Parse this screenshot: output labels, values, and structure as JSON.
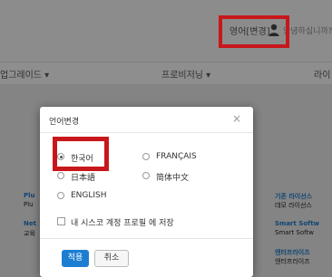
{
  "header": {
    "lang_link": "영어[변경]",
    "greeting": "안녕하십니까?"
  },
  "nav": {
    "items": [
      {
        "label": "업그레이드 ▾"
      },
      {
        "label": "프로비저닝 ▾"
      },
      {
        "label": "라이"
      }
    ]
  },
  "background": {
    "left": [
      "Plu",
      "Plu",
      "Net",
      "교육"
    ],
    "right": [
      "기존 라이선스",
      "데모 라이선스",
      "Smart Softw",
      "Smart Softw",
      "엔터프라이즈",
      "엔터프라이즈"
    ]
  },
  "modal": {
    "title": "언어변경",
    "close": "×",
    "options": [
      {
        "label": "한국어",
        "checked": true
      },
      {
        "label": "FRANÇAIS",
        "checked": false
      },
      {
        "label": "日本語",
        "checked": false
      },
      {
        "label": "简体中文",
        "checked": false
      },
      {
        "label": "ENGLISH",
        "checked": false
      }
    ],
    "save_profile_label": "내 시스코 계정 프로필 에 저장",
    "apply_label": "적용",
    "cancel_label": "취소"
  },
  "colors": {
    "highlight": "#c8171b",
    "primary": "#1d7ed1"
  }
}
